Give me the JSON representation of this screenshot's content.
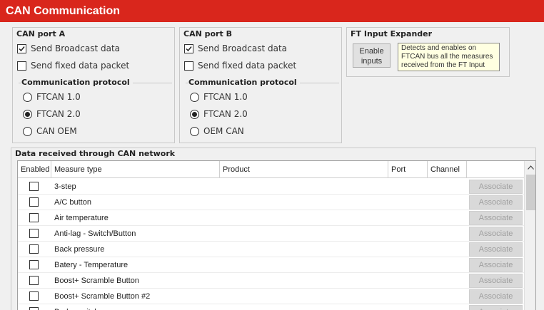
{
  "title": "CAN Communication",
  "port_a": {
    "title": "CAN port A",
    "send_broadcast": {
      "label": "Send Broadcast data",
      "checked": true
    },
    "send_fixed": {
      "label": "Send fixed data packet",
      "checked": false
    },
    "protocol_title": "Communication protocol",
    "options": [
      {
        "label": "FTCAN 1.0",
        "selected": false
      },
      {
        "label": "FTCAN 2.0",
        "selected": true
      },
      {
        "label": "CAN OEM",
        "selected": false
      }
    ]
  },
  "port_b": {
    "title": "CAN port B",
    "send_broadcast": {
      "label": "Send Broadcast data",
      "checked": true
    },
    "send_fixed": {
      "label": "Send fixed data packet",
      "checked": false
    },
    "protocol_title": "Communication protocol",
    "options": [
      {
        "label": "FTCAN 1.0",
        "selected": false
      },
      {
        "label": "FTCAN 2.0",
        "selected": true
      },
      {
        "label": "OEM CAN",
        "selected": false
      }
    ]
  },
  "ft_input": {
    "title": "FT Input Expander",
    "button_line1": "Enable",
    "button_line2": "inputs",
    "tooltip_line1": "Detects and enables on",
    "tooltip_line2": "FTCAN bus all the measures",
    "tooltip_line3": "received from the FT Input"
  },
  "data_section": {
    "title": "Data received through CAN network",
    "columns": [
      "Enabled",
      "Measure type",
      "Product",
      "Port",
      "Channel"
    ],
    "associate_label": "Associate",
    "rows": [
      {
        "measure": "3-step",
        "enabled": false
      },
      {
        "measure": "A/C button",
        "enabled": false
      },
      {
        "measure": "Air temperature",
        "enabled": false
      },
      {
        "measure": "Anti-lag - Switch/Button",
        "enabled": false
      },
      {
        "measure": "Back pressure",
        "enabled": false
      },
      {
        "measure": "Batery - Temperature",
        "enabled": false
      },
      {
        "measure": "Boost+ Scramble Button",
        "enabled": false
      },
      {
        "measure": "Boost+ Scramble Button #2",
        "enabled": false
      },
      {
        "measure": "Brake switch",
        "enabled": false
      }
    ]
  }
}
